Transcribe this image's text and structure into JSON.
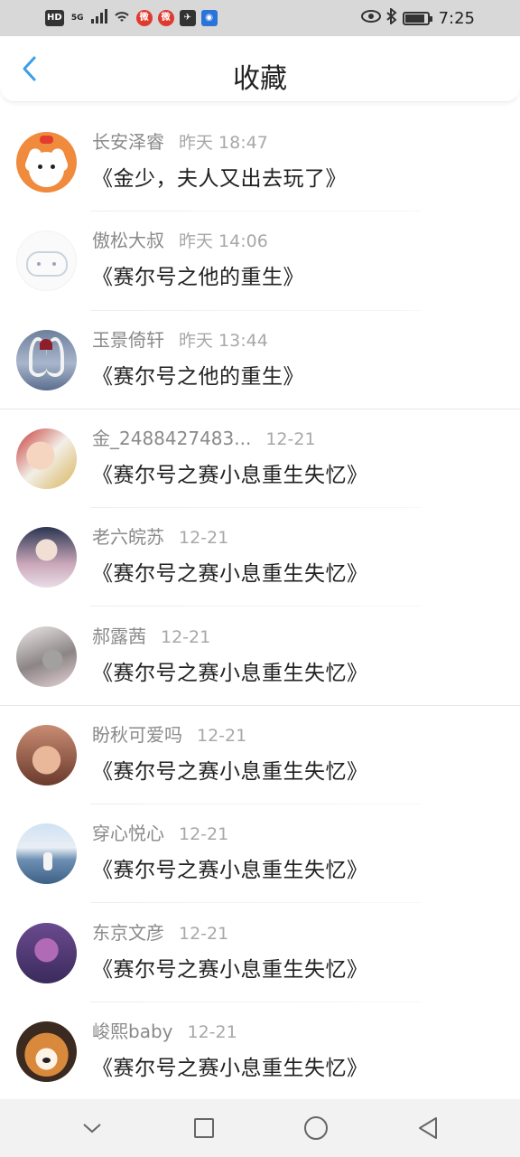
{
  "status_bar": {
    "time": "7:25",
    "network": "5G",
    "hd": "HD",
    "app_icons": [
      "weibo-icon",
      "weibo-icon",
      "messenger-icon",
      "bulb-icon"
    ],
    "right_icons": [
      "eye-icon",
      "bluetooth-icon",
      "battery-icon"
    ]
  },
  "header": {
    "title": "收藏",
    "back_icon": "chevron-left-icon",
    "accent_color": "#3a9ee8"
  },
  "favorites": [
    {
      "username": "长安泽睿",
      "time": "昨天 18:47",
      "title": "《金少，夫人又出去玩了》",
      "avatar": "cartoon-dog"
    },
    {
      "username": "傲松大叔",
      "time": "昨天 14:06",
      "title": "《赛尔号之他的重生》",
      "avatar": "cat-doodle"
    },
    {
      "username": "玉景倚轩",
      "time": "昨天 13:44",
      "title": "《赛尔号之他的重生》",
      "avatar": "swans-heart"
    },
    {
      "username": "金_2488427483...",
      "time": "12-21",
      "title": "《赛尔号之赛小息重生失忆》",
      "avatar": "anime-girl"
    },
    {
      "username": "老六皖苏",
      "time": "12-21",
      "title": "《赛尔号之赛小息重生失忆》",
      "avatar": "lady-portrait"
    },
    {
      "username": "郝露茜",
      "time": "12-21",
      "title": "《赛尔号之赛小息重生失忆》",
      "avatar": "monochrome-photo"
    },
    {
      "username": "盼秋可爱吗",
      "time": "12-21",
      "title": "《赛尔号之赛小息重生失忆》",
      "avatar": "hands-photo"
    },
    {
      "username": "穿心悦心",
      "time": "12-21",
      "title": "《赛尔号之赛小息重生失忆》",
      "avatar": "sea-photo"
    },
    {
      "username": "东京文彦",
      "time": "12-21",
      "title": "《赛尔号之赛小息重生失忆》",
      "avatar": "purple-character"
    },
    {
      "username": "峻熙baby",
      "time": "12-21",
      "title": "《赛尔号之赛小息重生失忆》",
      "avatar": "shiba-dog"
    }
  ],
  "nav_bar": {
    "buttons": [
      "chevron-down-icon",
      "square-icon",
      "circle-icon",
      "triangle-back-icon"
    ]
  }
}
